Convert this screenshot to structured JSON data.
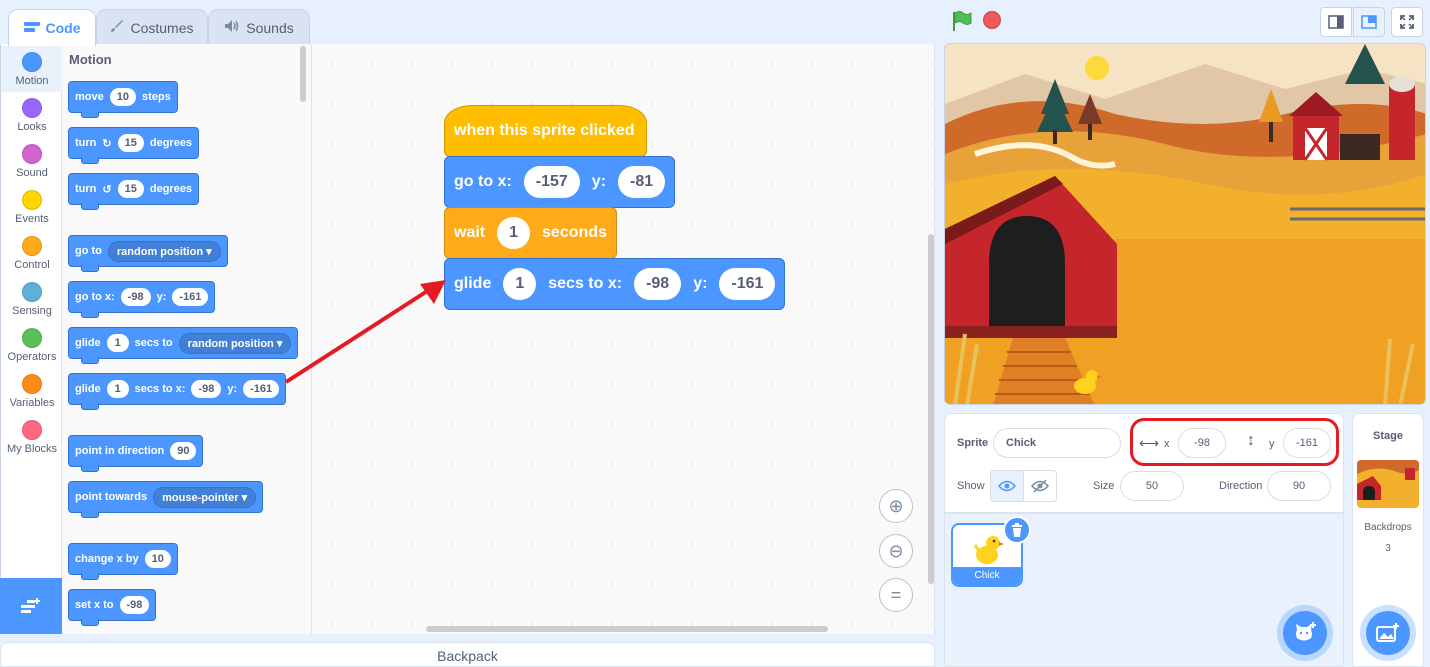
{
  "tabs": {
    "code": "Code",
    "costumes": "Costumes",
    "sounds": "Sounds"
  },
  "categories": [
    {
      "label": "Motion",
      "color": "#4c97ff"
    },
    {
      "label": "Looks",
      "color": "#9966ff"
    },
    {
      "label": "Sound",
      "color": "#cf63cf"
    },
    {
      "label": "Events",
      "color": "#ffd500"
    },
    {
      "label": "Control",
      "color": "#ffab19"
    },
    {
      "label": "Sensing",
      "color": "#5cb1d6"
    },
    {
      "label": "Operators",
      "color": "#59c059"
    },
    {
      "label": "Variables",
      "color": "#ff8c1a"
    },
    {
      "label": "My Blocks",
      "color": "#ff6680"
    }
  ],
  "palette": {
    "title": "Motion",
    "move": {
      "pre": "move",
      "steps": "10",
      "post": "steps"
    },
    "turn_right": {
      "pre": "turn",
      "deg": "15",
      "post": "degrees"
    },
    "turn_left": {
      "pre": "turn",
      "deg": "15",
      "post": "degrees"
    },
    "goto": {
      "pre": "go to",
      "target": "random position"
    },
    "gotoxy": {
      "pre": "go to x:",
      "x": "-98",
      "ylabel": "y:",
      "y": "-161"
    },
    "glide_to": {
      "pre": "glide",
      "secs": "1",
      "mid": "secs to",
      "target": "random position"
    },
    "glide_xy": {
      "pre": "glide",
      "secs": "1",
      "mid": "secs to x:",
      "x": "-98",
      "ylabel": "y:",
      "y": "-161"
    },
    "point_dir": {
      "pre": "point in direction",
      "dir": "90"
    },
    "point_towards": {
      "pre": "point towards",
      "target": "mouse-pointer"
    },
    "change_x": {
      "pre": "change x by",
      "val": "10"
    },
    "set_x": {
      "pre": "set x to",
      "val": "-98"
    }
  },
  "script": {
    "hat": "when this sprite clicked",
    "goto": {
      "pre": "go to x:",
      "x": "-157",
      "ylabel": "y:",
      "y": "-81"
    },
    "wait": {
      "pre": "wait",
      "secs": "1",
      "post": "seconds"
    },
    "glide": {
      "pre": "glide",
      "secs": "1",
      "mid": "secs to x:",
      "x": "-98",
      "ylabel": "y:",
      "y": "-161"
    }
  },
  "zoom": {
    "in": "+",
    "out": "−",
    "reset": "="
  },
  "backpack": "Backpack",
  "sprite_info": {
    "sprite_label": "Sprite",
    "sprite_name": "Chick",
    "x_label": "x",
    "x": "-98",
    "y_label": "y",
    "y": "-161",
    "show_label": "Show",
    "size_label": "Size",
    "size": "50",
    "direction_label": "Direction",
    "direction": "90"
  },
  "sprite_list": [
    {
      "name": "Chick"
    }
  ],
  "stage_panel": {
    "title": "Stage",
    "backdrops_label": "Backdrops",
    "backdrops_count": "3"
  },
  "colors": {
    "motion": "#4c97ff",
    "events": "#ffbf00",
    "control": "#ffab19",
    "highlight": "#e51b24"
  }
}
